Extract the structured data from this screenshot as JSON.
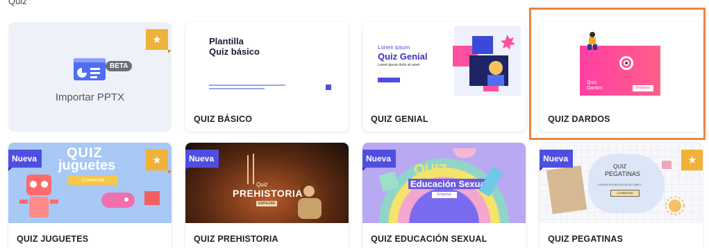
{
  "section": {
    "title": "Quiz"
  },
  "icons": {
    "star": "★"
  },
  "cards": [
    {
      "label": "Importar PPTX",
      "beta": "BETA",
      "starred": true
    },
    {
      "label": "QUIZ BÁSICO",
      "thumb_title_line1": "Plantilla",
      "thumb_title_line2": "Quiz básico"
    },
    {
      "label": "QUIZ GENIAL",
      "thumb_kicker": "Lorem ipsum",
      "thumb_title": "Quiz Genial",
      "thumb_sub": "Lorem ipsum dolor sit amet"
    },
    {
      "label": "QUIZ DARDOS",
      "thumb_title_line1": "Quiz",
      "thumb_title_line2": "Dardos",
      "thumb_button": "Empezar"
    },
    {
      "label": "QUIZ JUGUETES",
      "badge": "Nueva",
      "starred": true,
      "thumb_title_line1": "QUIZ",
      "thumb_title_line2": "juguetes",
      "thumb_button": "Comenzar"
    },
    {
      "label": "QUIZ PREHISTORIA",
      "badge": "Nueva",
      "thumb_title_line1": "Quiz",
      "thumb_title_line2": "PREHISTORIA",
      "thumb_button": "EMPEZAR"
    },
    {
      "label": "QUIZ EDUCACIÓN SEXUAL",
      "badge": "Nueva",
      "thumb_title_line1": "QUIZ",
      "thumb_title_line2": "Educación Sexual",
      "thumb_button": "Empezar"
    },
    {
      "label": "QUIZ PEGATINAS",
      "badge": "Nueva",
      "starred": true,
      "thumb_title_line1": "QUIZ",
      "thumb_title_line2": "PEGATINAS",
      "thumb_sub": "LOREM IPSUM DOLOR SIT AMET",
      "thumb_button": "COMENZAR"
    }
  ],
  "colors": {
    "star_badge": "#f0b23a",
    "nueva_badge": "#4f4ee0",
    "highlight": "#e9853d",
    "import_bg": "#eef1f8"
  }
}
